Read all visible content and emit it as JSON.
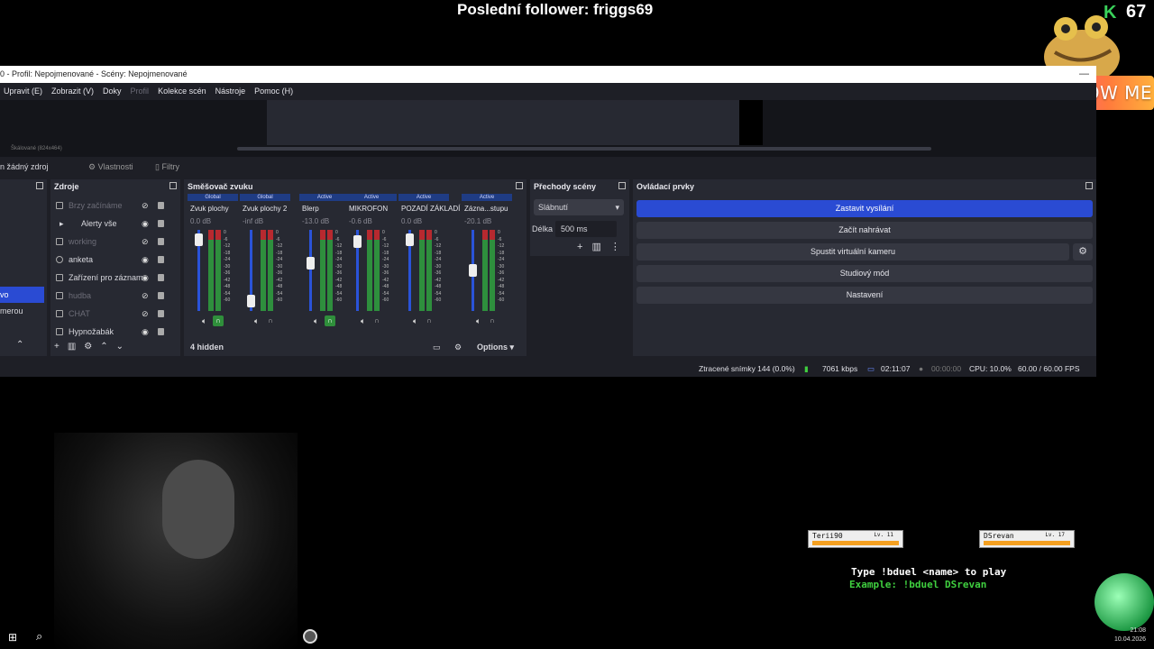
{
  "overlay": {
    "follower_text": "Poslední follower: friggs69",
    "follow_count": "67",
    "follow_me": "FOLLOW ME",
    "kick_logo": "K"
  },
  "obs": {
    "title": "0 - Profil: Nepojmenované - Scény: Nepojmenované",
    "menu": [
      "Upravit (E)",
      "Zobrazit (V)",
      "Doky",
      "Profil",
      "Kolekce scén",
      "Nástroje",
      "Pomoc (H)"
    ],
    "scale_label": "Škálované (824x464)",
    "no_source": "n žádný zdroj",
    "properties_button": "Vlastnosti",
    "filters_button": "Filtry",
    "scenes_dock": {
      "items": [
        "vo",
        "merou"
      ]
    },
    "sources_dock": {
      "title": "Zdroje",
      "items": [
        {
          "label": "Brzy začínáme",
          "dim": true
        },
        {
          "label": "Alerty vše",
          "dim": false
        },
        {
          "label": "working",
          "dim": true
        },
        {
          "label": "anketa",
          "dim": false
        },
        {
          "label": "Zařízení pro záznam",
          "dim": false
        },
        {
          "label": "hudba",
          "dim": true
        },
        {
          "label": "CHAT",
          "dim": true
        },
        {
          "label": "Hypnožabák",
          "dim": false
        }
      ]
    },
    "mixer_dock": {
      "title": "Směšovač zvuku",
      "channels": [
        {
          "tag": "Global",
          "name": "Zvuk plochy",
          "db": "0.0 dB",
          "level": 0.95,
          "monitor": true
        },
        {
          "tag": "Global",
          "name": "Zvuk plochy 2",
          "db": "-inf dB",
          "level": 0.05,
          "monitor": false
        },
        {
          "tag": "Active",
          "name": "Blerp",
          "db": "-13.0 dB",
          "level": 0.6,
          "monitor": true
        },
        {
          "tag": "Active",
          "name": "MIKROFON",
          "db": "-0.6 dB",
          "level": 0.92,
          "monitor": false
        },
        {
          "tag": "Active",
          "name": "POZADÍ ZÁKLADÍ",
          "db": "0.0 dB",
          "level": 0.95,
          "monitor": false
        },
        {
          "tag": "Active",
          "name": "Zázna...stupu",
          "db": "-20.1 dB",
          "level": 0.5,
          "monitor": false
        }
      ],
      "scale": [
        "0",
        "-6",
        "-12",
        "-18",
        "-24",
        "-30",
        "-36",
        "-42",
        "-48",
        "-54",
        "-60"
      ],
      "hidden": "4 hidden",
      "options": "Options"
    },
    "transitions_dock": {
      "title": "Přechody scény",
      "transition": "Slábnutí",
      "duration_label": "Délka",
      "duration": "500 ms"
    },
    "controls_dock": {
      "title": "Ovládací prvky",
      "buttons": [
        "Zastavit vysílání",
        "Začít nahrávat",
        "Spustit virtuální kameru",
        "Studiový mód",
        "Nastavení"
      ]
    },
    "status": {
      "dropped": "Ztracené snímky 144 (0.0%)",
      "bitrate": "7061 kbps",
      "stream_time": "02:11:07",
      "rec_time": "00:00:00",
      "cpu": "CPU: 10.0%",
      "fps": "60.00 / 60.00 FPS"
    }
  },
  "duel": {
    "player1": "Terii90",
    "player1_lv": "Lv. 11",
    "player2": "DSrevan",
    "player2_lv": "Lv. 17",
    "help": "Type !bduel <name> to play",
    "example": "Example: !bduel DSrevan"
  },
  "taskbar": {
    "time": "21:08",
    "date": "10.04.2026"
  }
}
